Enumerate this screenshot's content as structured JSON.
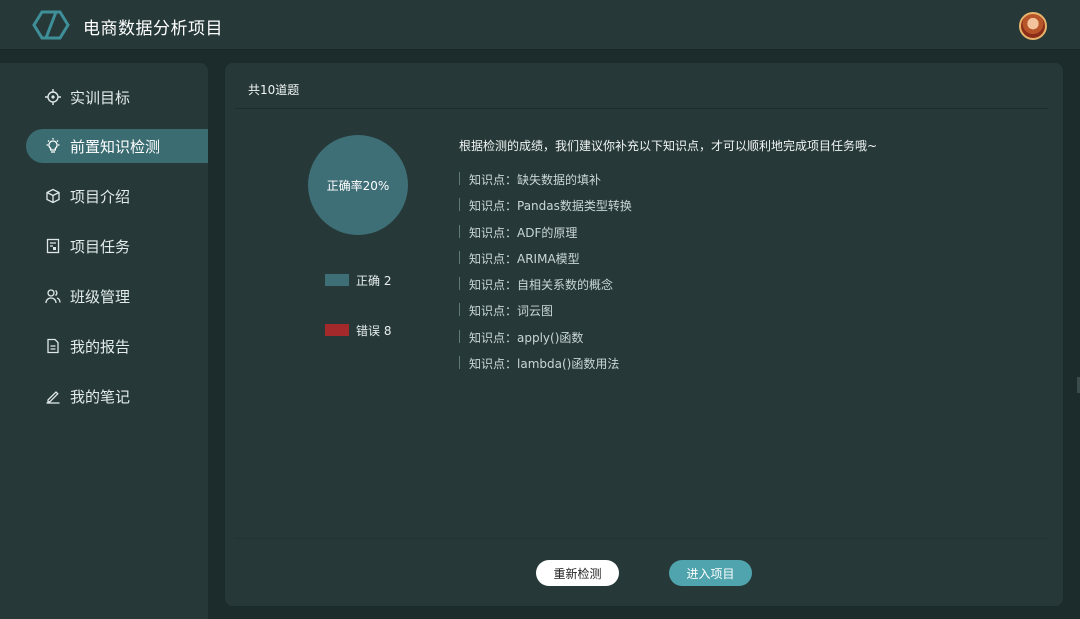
{
  "app": {
    "title": "电商数据分析项目"
  },
  "sidebar": {
    "items": [
      {
        "label": "实训目标",
        "icon": "target-icon"
      },
      {
        "label": "前置知识检测",
        "icon": "lightbulb-icon",
        "active": true
      },
      {
        "label": "项目介绍",
        "icon": "cube-icon"
      },
      {
        "label": "项目任务",
        "icon": "task-icon"
      },
      {
        "label": "班级管理",
        "icon": "users-icon"
      },
      {
        "label": "我的报告",
        "icon": "document-icon"
      },
      {
        "label": "我的笔记",
        "icon": "pen-icon"
      }
    ]
  },
  "quiz": {
    "count_label": "共10道题",
    "pie_label": "正确率20%",
    "legend": [
      {
        "label": "正确 2",
        "color": "#3e6e76"
      },
      {
        "label": "错误 8",
        "color": "#a3292a"
      }
    ],
    "advice": "根据检测的成绩，我们建议你补充以下知识点，才可以顺利地完成项目任务哦~",
    "knowledge_points": [
      "知识点：缺失数据的填补",
      "知识点：Pandas数据类型转换",
      "知识点：ADF的原理",
      "知识点：ARIMA模型",
      "知识点：自相关系数的概念",
      "知识点：词云图",
      "知识点：apply()函数",
      "知识点：lambda()函数用法"
    ]
  },
  "chart_data": {
    "type": "pie",
    "categories": [
      "正确",
      "错误"
    ],
    "values": [
      2,
      8
    ],
    "colors": [
      "#3e6e76",
      "#a3292a"
    ]
  },
  "actions": {
    "retest_label": "重新检测",
    "enter_label": "进入项目"
  },
  "colors": {
    "accent": "#4fa4ad",
    "active_nav": "#3a6c72",
    "panel": "#263838",
    "background": "#1c2c2c"
  }
}
